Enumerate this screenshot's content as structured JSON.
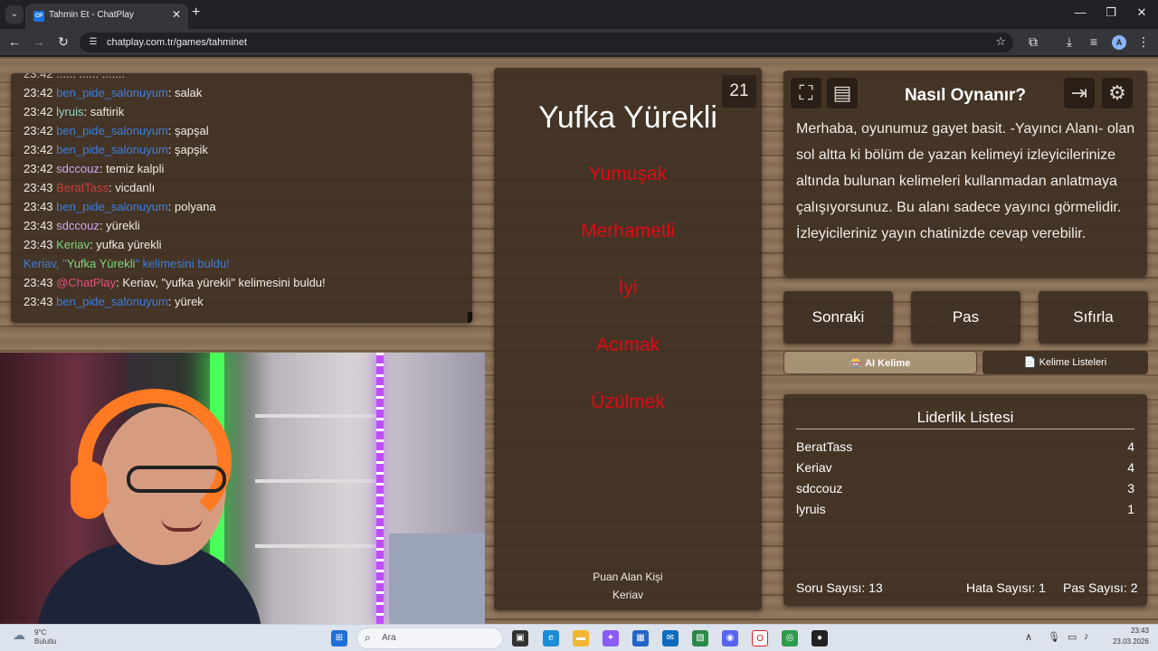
{
  "browser": {
    "tab_title": "Tahmin Et - ChatPlay",
    "tab_favicon": "CP",
    "url": "chatplay.com.tr/games/tahminet",
    "profile_initial": "A"
  },
  "chat": {
    "cut_line": "23:42 ...... ...... .......",
    "messages": [
      {
        "time": "23:42",
        "user": "ben_pide_salonuyum",
        "color": "#3d7edb",
        "text": ": salak"
      },
      {
        "time": "23:42",
        "user": "lyruis",
        "color": "#8fd6c8",
        "text": ": saftirik"
      },
      {
        "time": "23:42",
        "user": "ben_pide_salonuyum",
        "color": "#3d7edb",
        "text": ": şapşal"
      },
      {
        "time": "23:42",
        "user": "ben_pide_salonuyum",
        "color": "#3d7edb",
        "text": ": şapşik"
      },
      {
        "time": "23:42",
        "user": "sdccouz",
        "color": "#d0a8f0",
        "text": ": temiz kalpli"
      },
      {
        "time": "23:43",
        "user": "BeratTass",
        "color": "#d63b3b",
        "text": ": vicdanlı"
      },
      {
        "time": "23:43",
        "user": "ben_pide_salonuyum",
        "color": "#3d7edb",
        "text": ": polyana"
      },
      {
        "time": "23:43",
        "user": "sdccouz",
        "color": "#d0a8f0",
        "text": ": yürekli"
      },
      {
        "time": "23:43",
        "user": "Keriav",
        "color": "#7ed87e",
        "text": ": yufka yürekli"
      }
    ],
    "found_notice": {
      "prefix": "Keriav, \"",
      "word": "Yufka Yürekli",
      "suffix": "\" kelimesini buldu!"
    },
    "bot_message": {
      "time": "23:43",
      "user": "@ChatPlay",
      "text": ": Keriav, \"yufka yürekli\" kelimesini buldu!"
    },
    "last_message": {
      "time": "23:43",
      "user": "ben_pide_salonuyum",
      "text": ": yürek"
    }
  },
  "game": {
    "counter": "21",
    "main_word": "Yufka Yürekli",
    "forbidden_words": [
      "Yumuşak",
      "Merhametli",
      "İyi",
      "Acımak",
      "Üzülmek"
    ],
    "scorer_title": "Puan Alan Kişi",
    "scorer_name": "Keriav"
  },
  "info": {
    "title": "Nasıl Oynanır?",
    "text": "Merhaba, oyunumuz gayet basit. -Yayıncı Alanı- olan sol altta ki bölüm de yazan kelimeyi izleyicilerinize altında bulunan kelimeleri kullanmadan anlatmaya çalışıyorsunuz. Bu alanı sadece yayıncı görmelidir. İzleyicileriniz yayın chatinizde cevap verebilir."
  },
  "buttons": {
    "next": "Sonraki",
    "pass": "Pas",
    "reset": "Sıfırla",
    "ai_word": "🎰 AI Kelime",
    "word_lists": "📄 Kelime Listeleri"
  },
  "leaderboard": {
    "title": "Liderlik Listesi",
    "rows": [
      {
        "name": "BeratTass",
        "score": "4"
      },
      {
        "name": "Keriav",
        "score": "4"
      },
      {
        "name": "sdccouz",
        "score": "3"
      },
      {
        "name": "lyruis",
        "score": "1"
      }
    ],
    "questions": "Soru Sayısı: 13",
    "errors": "Hata Sayısı: 1",
    "passes": "Pas Sayısı: 2"
  },
  "taskbar": {
    "temp": "9°C",
    "weather": "Bulutlu",
    "search_placeholder": "Ara",
    "time": "23:43",
    "date": "23.03.2026"
  }
}
